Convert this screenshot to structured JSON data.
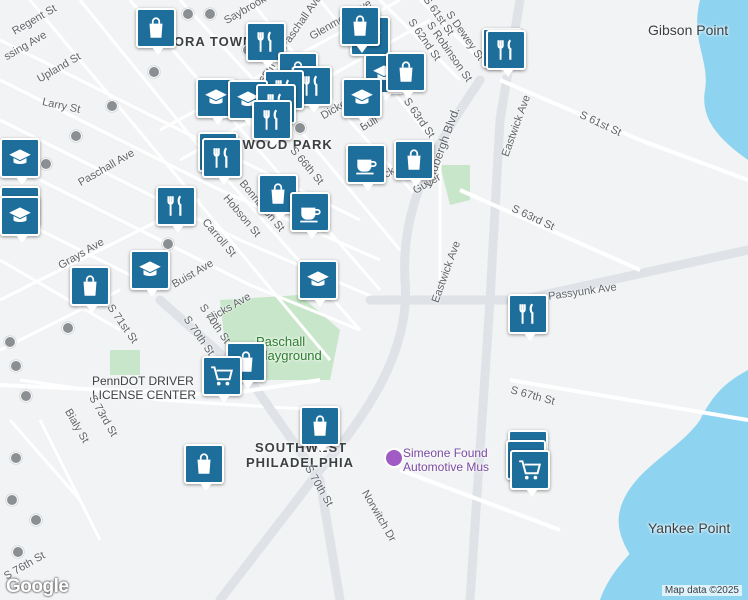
{
  "map": {
    "neighborhoods": [
      "ANGORA TOWN",
      "ELMWOOD PARK",
      "SOUTHWEST",
      "PHILADELPHIA"
    ],
    "places": [
      "Gibson Point",
      "Yankee Point"
    ],
    "parks": [
      "Paschall",
      "Playground"
    ],
    "pois": [
      "PennDOT DRIVER",
      "LICENSE CENTER",
      "Simeone Found",
      "Automotive Mus"
    ],
    "streets": [
      "Regent St",
      "Upland St",
      "Larry St",
      "Paschall Ave",
      "Grays Ave",
      "S 71st St",
      "S 70th St",
      "S 73rd St",
      "Bialy St",
      "S 76th St",
      "Buist Ave",
      "Dicks Ave",
      "Carroll St",
      "Hobson St",
      "Bonnaffon St",
      "S 66th St",
      "S 65th St",
      "Guyer",
      "Dicks",
      "Bull",
      "Dicke",
      "S 63rd St",
      "S Robinson St",
      "S 62nd St",
      "S Dewey St",
      "S 61st St",
      "Saybrook",
      "Glenmore Ave",
      "Paschall Ave",
      "Lindbergh Blvd.",
      "Eastwick Ave",
      "Passyunk Ave",
      "S 67th St",
      "Norwitch Dr",
      "ssing Ave",
      "S 70th St",
      "S 76th St"
    ],
    "attribution": "Map data ©2025",
    "logo": "Google"
  },
  "markers": [
    {
      "type": "shopping",
      "icon": "shopping-bag-icon"
    },
    {
      "type": "education",
      "icon": "graduation-cap-icon"
    },
    {
      "type": "restaurant",
      "icon": "fork-knife-icon"
    },
    {
      "type": "cafe",
      "icon": "coffee-cup-icon"
    },
    {
      "type": "grocery",
      "icon": "shopping-cart-icon"
    }
  ],
  "colors": {
    "background": "#f1f3f4",
    "water": "#8ed3f0",
    "park": "#c8e6c9",
    "marker": "#1e6e9c",
    "road": "#ffffff",
    "highway": "#dfe3e8"
  }
}
